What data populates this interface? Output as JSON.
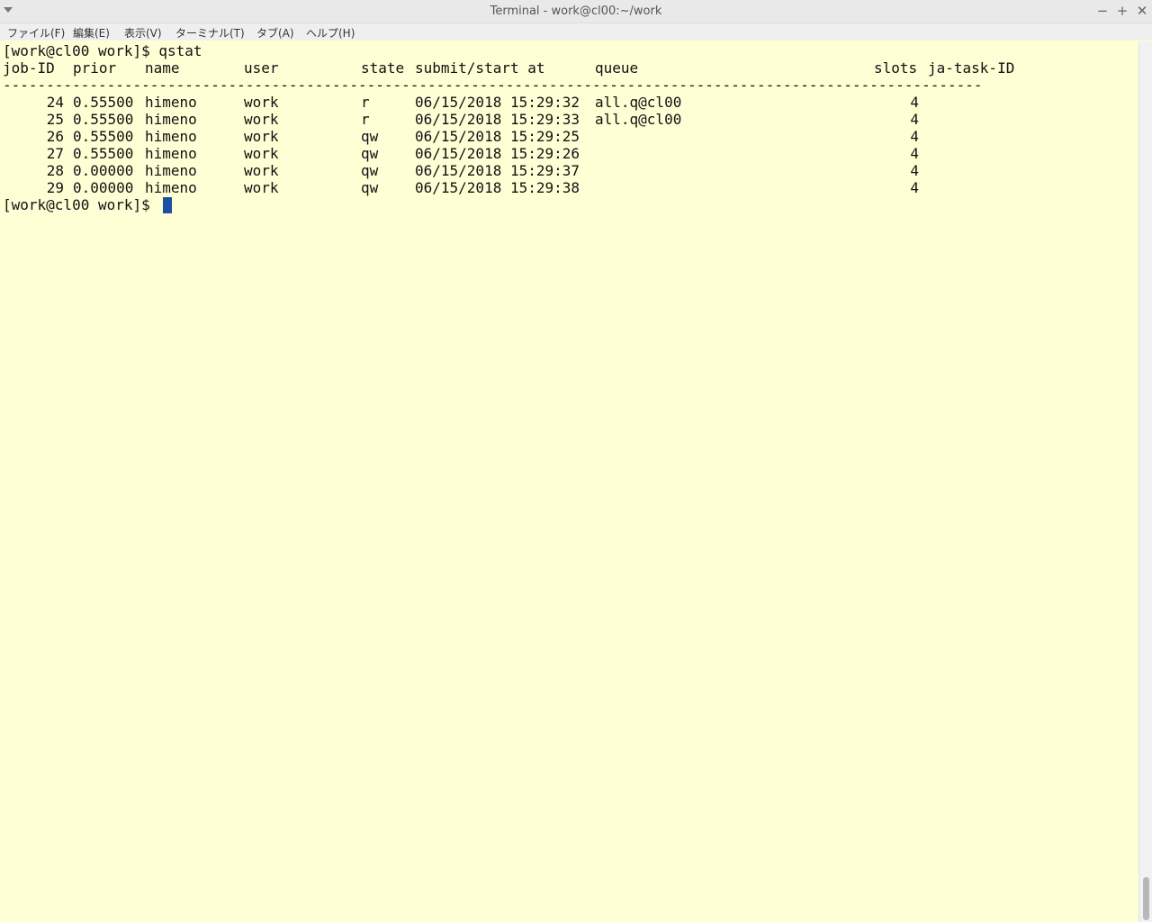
{
  "window": {
    "title": "Terminal - work@cl00:~/work"
  },
  "controls": {
    "minimize": "−",
    "maximize": "+",
    "close": "✕"
  },
  "menu": [
    "ファイル(F)",
    "編集(E)",
    "表示(V)",
    "ターミナル(T)",
    "タブ(A)",
    "ヘルプ(H)"
  ],
  "terminal": {
    "command_line": "[work@cl00 work]$ qstat",
    "headers": {
      "jobid": "job-ID",
      "prior": "prior",
      "name": "name",
      "user": "user",
      "state": "state",
      "submit": "submit/start at",
      "queue": "queue",
      "slots": "slots",
      "tasks": "ja-task-ID"
    },
    "separator": "-----------------------------------------------------------------------------------------------------------------",
    "jobs": [
      {
        "id": "24",
        "prior": "0.55500",
        "name": "himeno",
        "user": "work",
        "state": "r",
        "submit": "06/15/2018 15:29:32",
        "queue": "all.q@cl00",
        "slots": "4"
      },
      {
        "id": "25",
        "prior": "0.55500",
        "name": "himeno",
        "user": "work",
        "state": "r",
        "submit": "06/15/2018 15:29:33",
        "queue": "all.q@cl00",
        "slots": "4"
      },
      {
        "id": "26",
        "prior": "0.55500",
        "name": "himeno",
        "user": "work",
        "state": "qw",
        "submit": "06/15/2018 15:29:25",
        "queue": "",
        "slots": "4"
      },
      {
        "id": "27",
        "prior": "0.55500",
        "name": "himeno",
        "user": "work",
        "state": "qw",
        "submit": "06/15/2018 15:29:26",
        "queue": "",
        "slots": "4"
      },
      {
        "id": "28",
        "prior": "0.00000",
        "name": "himeno",
        "user": "work",
        "state": "qw",
        "submit": "06/15/2018 15:29:37",
        "queue": "",
        "slots": "4"
      },
      {
        "id": "29",
        "prior": "0.00000",
        "name": "himeno",
        "user": "work",
        "state": "qw",
        "submit": "06/15/2018 15:29:38",
        "queue": "",
        "slots": "4"
      }
    ],
    "prompt": "[work@cl00 work]$ "
  },
  "colors": {
    "background": "#ffffd6",
    "cursor": "#1d4fa3"
  }
}
